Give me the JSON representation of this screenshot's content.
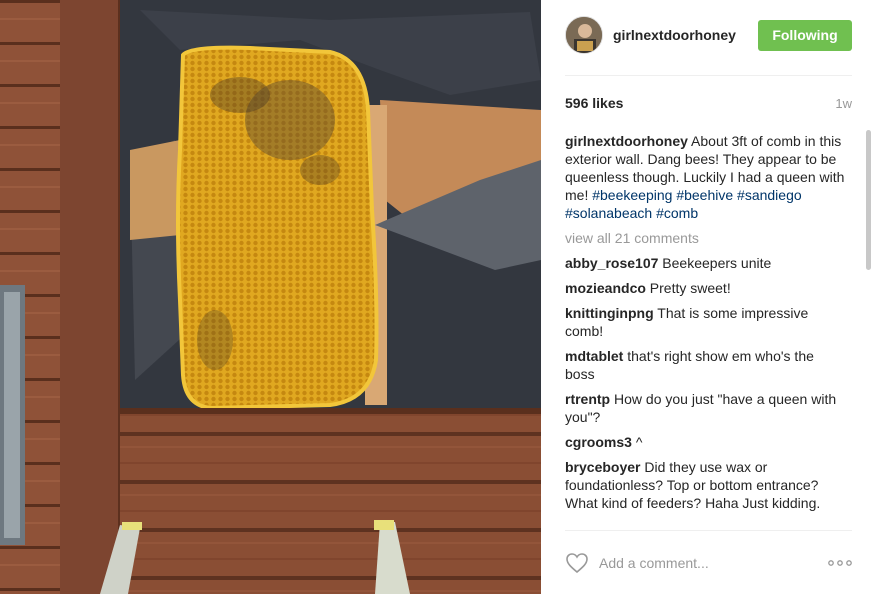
{
  "post": {
    "username": "girlnextdoorhoney",
    "follow_label": "Following",
    "likes": "596 likes",
    "time": "1w"
  },
  "caption": {
    "user": "girlnextdoorhoney",
    "text": "About 3ft of comb in this exterior wall. Dang bees! They appear to be queenless though. Luckily I had a queen with me!",
    "tags": [
      "#beekeeping",
      "#beehive",
      "#sandiego",
      "#solanabeach",
      "#comb"
    ]
  },
  "view_all": "view all 21 comments",
  "comments": [
    {
      "user": "abby_rose107",
      "text": "Beekeepers unite"
    },
    {
      "user": "mozieandco",
      "text": "Pretty sweet!"
    },
    {
      "user": "knittinginpng",
      "text": "That is some impressive comb!"
    },
    {
      "user": "mdtablet",
      "text": "that's right show em who's the boss"
    },
    {
      "user": "rtrentp",
      "text": "How do you just \"have a queen with you\"?"
    },
    {
      "user": "cgrooms3",
      "text": "^"
    },
    {
      "user": "bryceboyer",
      "text": "Did they use wax or foundationless? Top or bottom entrance? What kind of feeders? Haha Just kidding."
    }
  ],
  "footer": {
    "placeholder": "Add a comment..."
  },
  "icons": {
    "like": "heart-outline-icon",
    "more": "ellipsis-icon"
  },
  "colors": {
    "follow_button": "#70c050",
    "hashtag": "#003569",
    "muted": "#999999"
  }
}
